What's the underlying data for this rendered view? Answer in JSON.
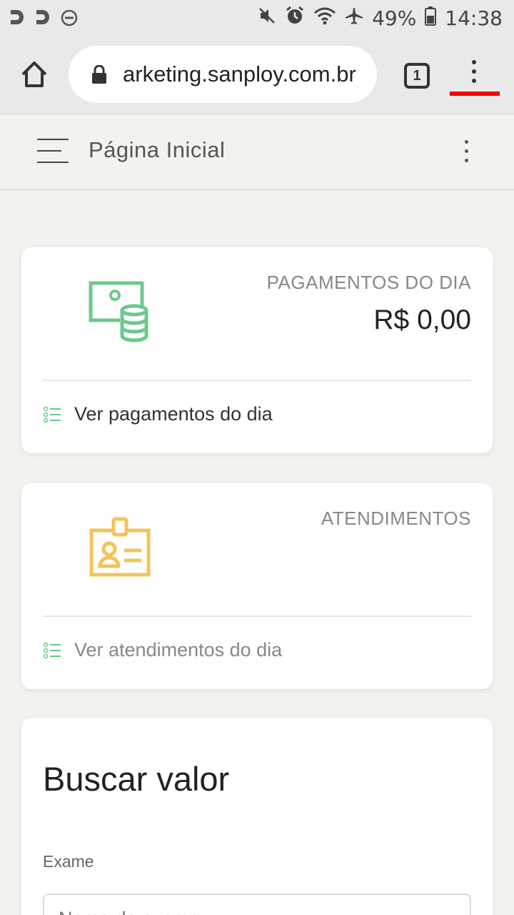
{
  "statusbar": {
    "battery": "49%",
    "time": "14:38",
    "left_icons": [
      "d-app-icon",
      "d-app-icon",
      "dnd-icon"
    ],
    "right_icons": [
      "mute-icon",
      "alarm-icon",
      "wifi-icon",
      "airplane-icon",
      "battery-icon"
    ]
  },
  "browser": {
    "url": "arketing.sanploy.com.br",
    "tab_count": "1"
  },
  "appbar": {
    "title": "Página Inicial"
  },
  "cards": {
    "payments": {
      "label": "PAGAMENTOS DO DIA",
      "value": "R$ 0,00",
      "link": "Ver pagamentos do dia",
      "icon": "money-coins-icon",
      "icon_color": "#6cc98c"
    },
    "attendances": {
      "label": "ATENDIMENTOS",
      "link": "Ver atendimentos do dia",
      "icon": "id-badge-icon",
      "icon_color": "#f2c458"
    }
  },
  "search": {
    "title": "Buscar valor",
    "field_label": "Exame",
    "placeholder": "Nome do exame"
  }
}
